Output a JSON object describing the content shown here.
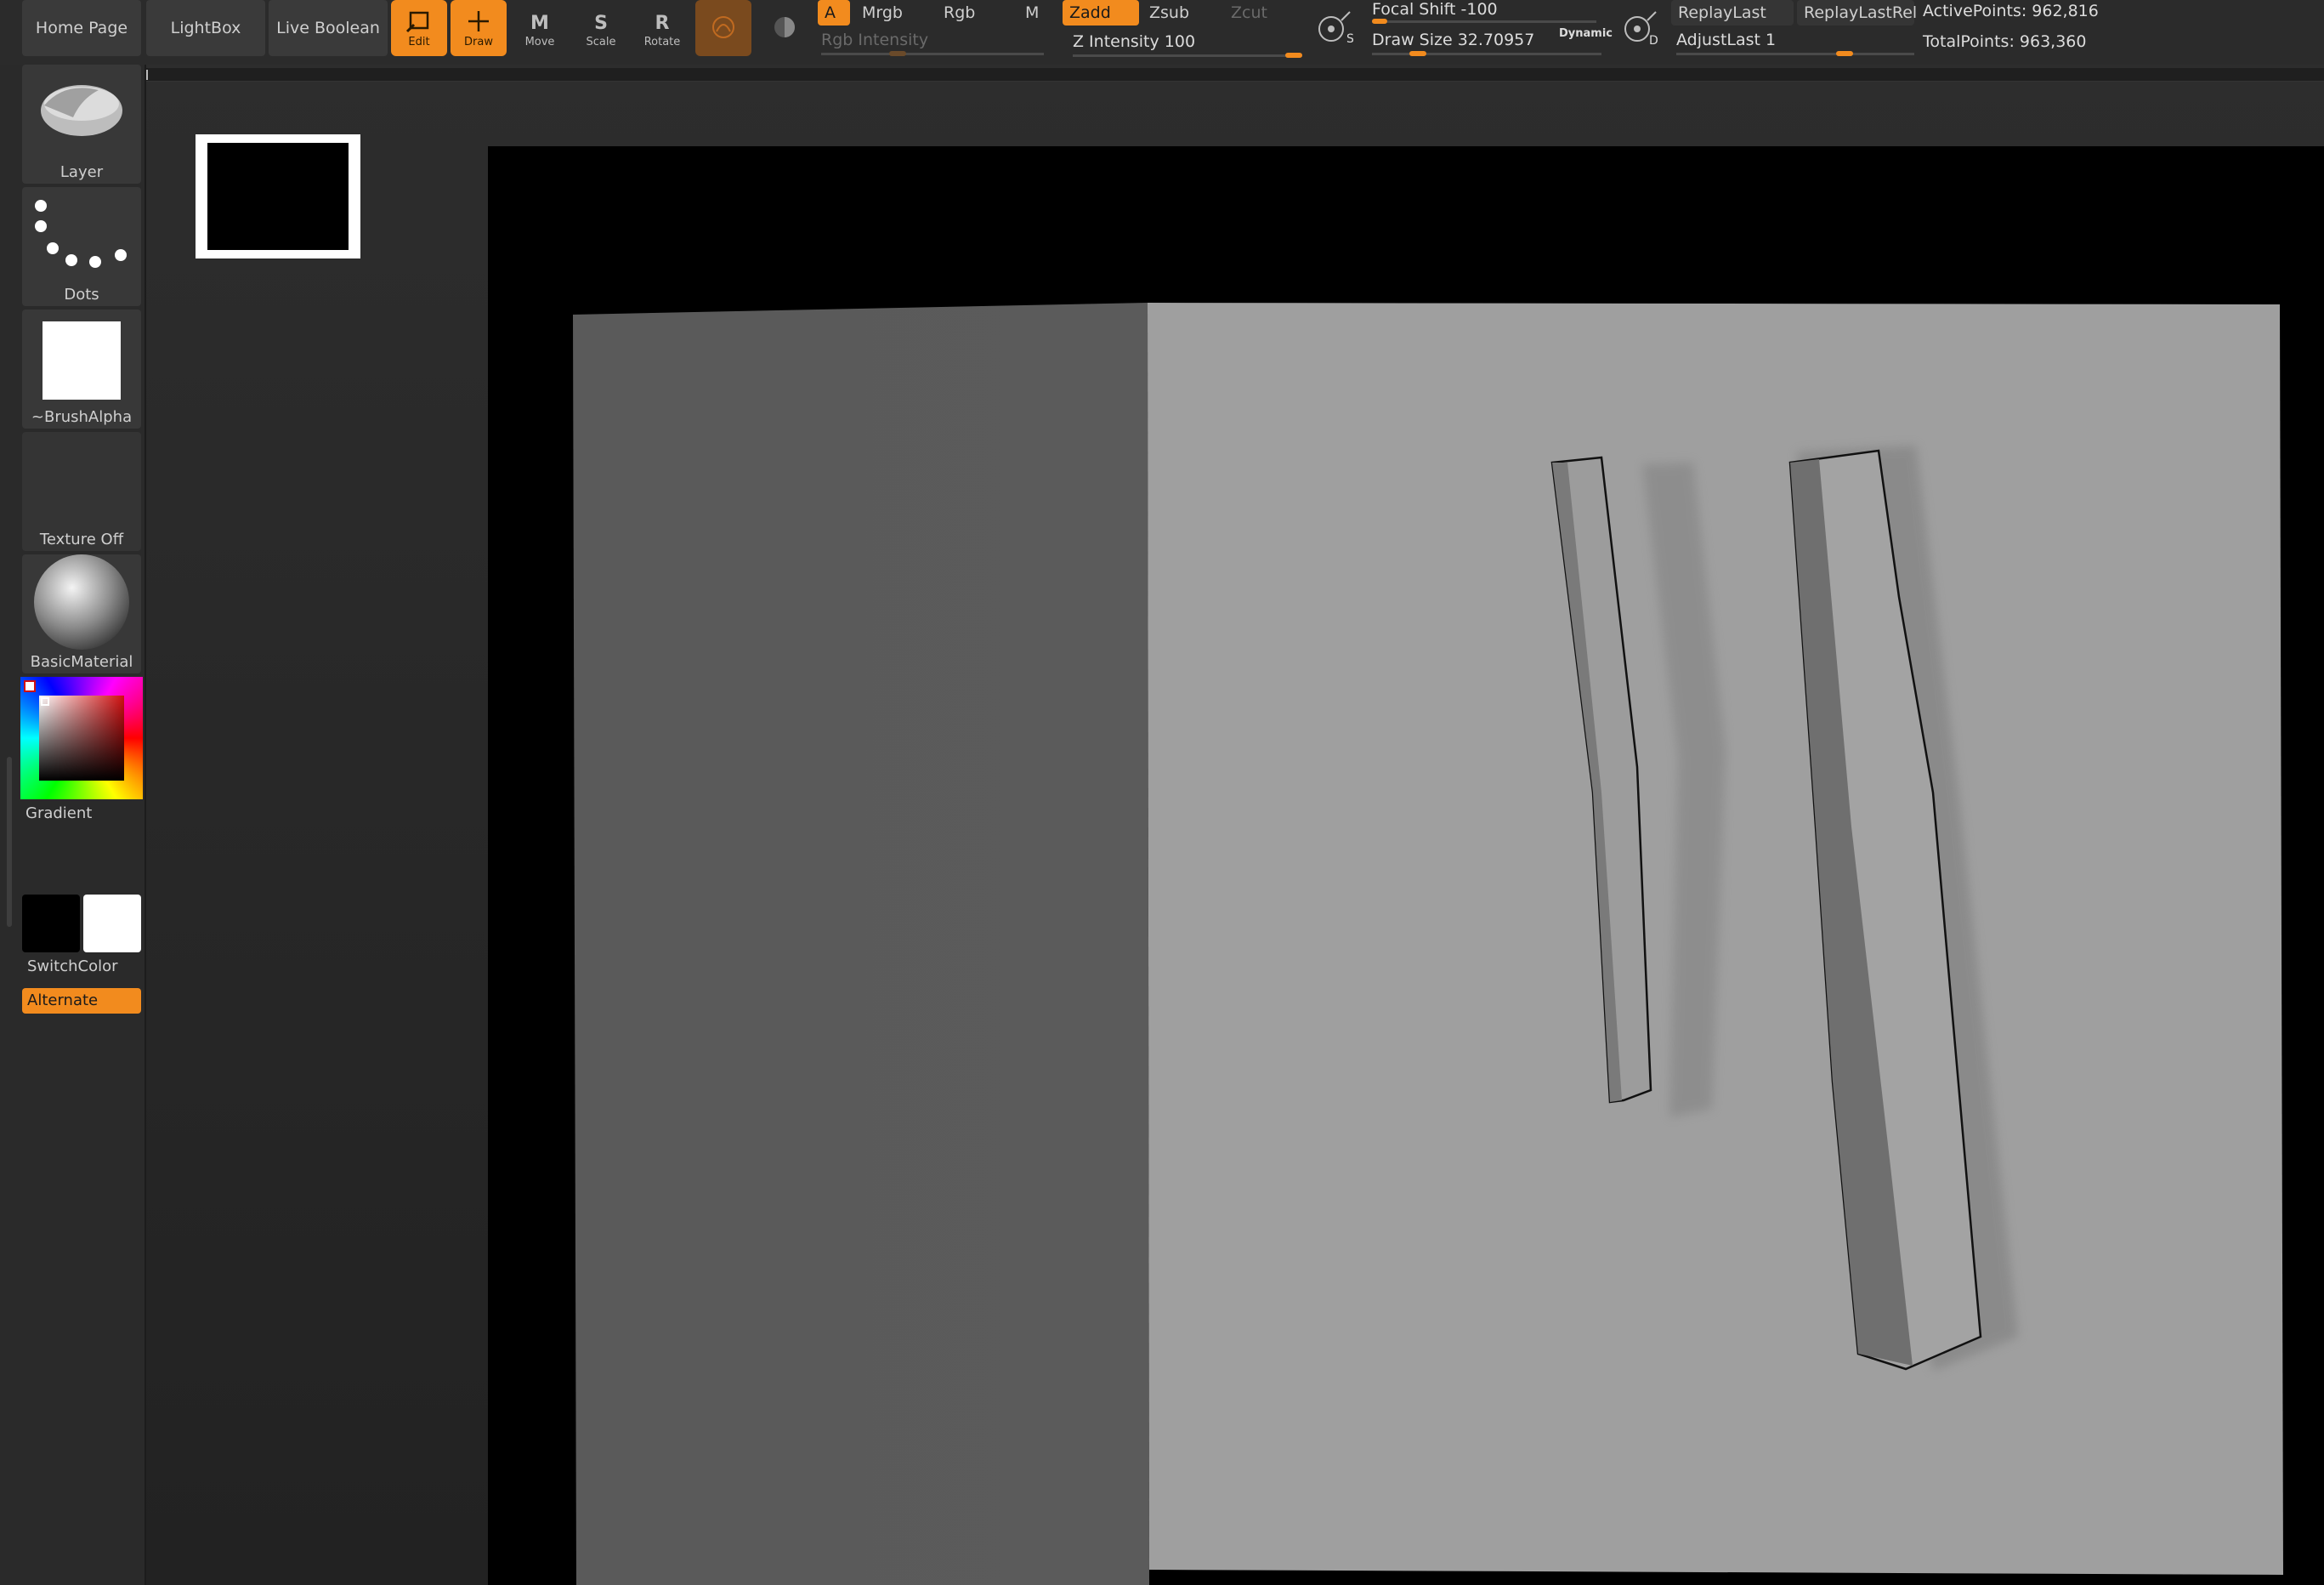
{
  "topbar": {
    "tabs": [
      {
        "label": "Home Page"
      },
      {
        "label": "LightBox"
      },
      {
        "label": "Live Boolean"
      }
    ],
    "tools": [
      {
        "label": "Edit",
        "icon": "edit-icon"
      },
      {
        "label": "Draw",
        "icon": "draw-icon"
      },
      {
        "label": "Move",
        "icon": "move-icon"
      },
      {
        "label": "Scale",
        "icon": "scale-icon"
      },
      {
        "label": "Rotate",
        "icon": "rotate-icon"
      }
    ],
    "modes": {
      "a": "A",
      "mrgb": "Mrgb",
      "rgb": "Rgb",
      "m": "M",
      "zadd": "Zadd",
      "zsub": "Zsub",
      "zcut": "Zcut"
    },
    "rgb_intensity_label": "Rgb Intensity",
    "z_intensity_label": "Z Intensity 100",
    "focal_shift_label": "Focal Shift -100",
    "draw_size_label": "Draw Size 32.70957",
    "dynamic_label": "Dynamic",
    "s_label": "S",
    "d_label": "D",
    "replay_last": "ReplayLast",
    "replay_last_rel": "ReplayLastRel",
    "adjust_last": "AdjustLast 1",
    "active_points": "ActivePoints: 962,816",
    "total_points": "TotalPoints: 963,360"
  },
  "shelf": {
    "brush": "Layer",
    "stroke": "Dots",
    "alpha": "~BrushAlpha",
    "texture": "Texture Off",
    "material": "BasicMaterial",
    "gradient": "Gradient",
    "switch_color": "SwitchColor",
    "alternate": "Alternate"
  },
  "colors": {
    "accent": "#f28b1e",
    "panel": "#2b2b2b",
    "button": "#3a3a3a"
  }
}
